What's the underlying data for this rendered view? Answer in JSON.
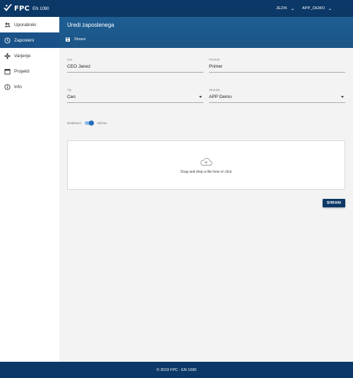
{
  "topbar": {
    "logo_main": "FPC",
    "logo_sub": "EN 1090",
    "language_menu": "JEZIK",
    "account_menu": "APP_DEMO"
  },
  "sidebar": {
    "items": [
      {
        "label": "Uporabniki",
        "icon": "users-icon",
        "active": false
      },
      {
        "label": "Zaposleni",
        "icon": "clock-icon",
        "active": true
      },
      {
        "label": "Varjenje",
        "icon": "gamepad-icon",
        "active": false
      },
      {
        "label": "Projekti",
        "icon": "calendar-icon",
        "active": false
      },
      {
        "label": "Info",
        "icon": "info-icon",
        "active": false
      }
    ]
  },
  "header": {
    "title": "Uredi zaposlenega",
    "save_label": "Shrani"
  },
  "form": {
    "ime": {
      "label": "Ime",
      "value": "CEO Janez"
    },
    "priimek": {
      "label": "Priimek",
      "value": "Primer"
    },
    "tip": {
      "label": "Tip",
      "value": "Ceo"
    },
    "stranka": {
      "label": "Stranka",
      "value": "APP Demo"
    },
    "status": {
      "off_label": "Neaktiven",
      "on_label": "Aktiven",
      "active": true
    }
  },
  "dropzone": {
    "text": "Drag and drop a file here or click",
    "icon": "cloud-upload-icon"
  },
  "save_button": "SHRANI",
  "footer": {
    "text": "© 2019 FPC - EN 1090"
  },
  "colors": {
    "primary": "#0b3866",
    "header": "#1a5586",
    "active_nav": "#1a5188",
    "toggle": "#1f6fbf"
  }
}
